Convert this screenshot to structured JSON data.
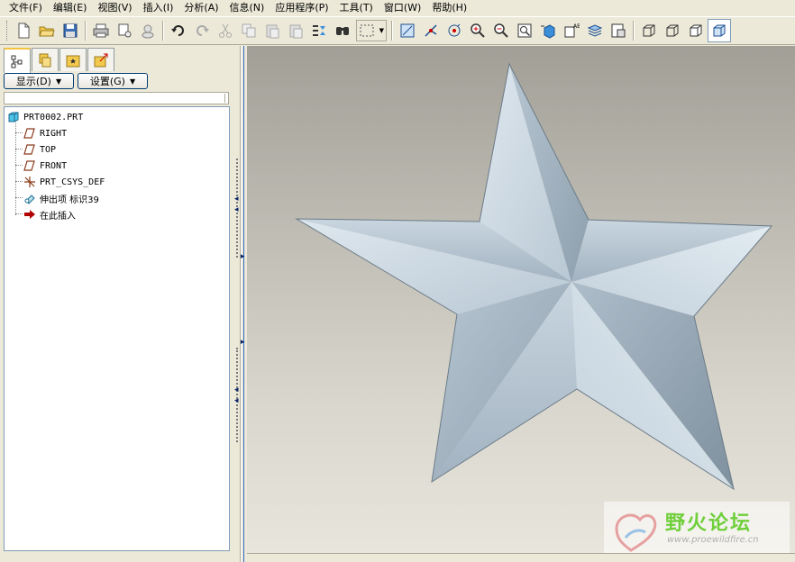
{
  "menubar": {
    "items": [
      {
        "label": "文件(F)"
      },
      {
        "label": "编辑(E)"
      },
      {
        "label": "视图(V)"
      },
      {
        "label": "插入(I)"
      },
      {
        "label": "分析(A)"
      },
      {
        "label": "信息(N)"
      },
      {
        "label": "应用程序(P)"
      },
      {
        "label": "工具(T)"
      },
      {
        "label": "窗口(W)"
      },
      {
        "label": "帮助(H)"
      }
    ]
  },
  "toolbar": {
    "icons": [
      "new-file-icon",
      "open-folder-icon",
      "save-icon",
      "print-icon",
      "send-mail-icon",
      "mail-recipient-icon",
      "undo-icon",
      "redo-icon",
      "cut-icon",
      "copy-icon",
      "paste-icon",
      "paste-special-icon",
      "regenerate-icon",
      "find-icon",
      "select-box-icon",
      "plane-display-icon",
      "axis-display-icon",
      "point-display-icon",
      "zoom-in-icon",
      "zoom-out-icon",
      "refit-icon",
      "reorient-icon",
      "saved-views-icon",
      "layers-icon",
      "view-manager-icon",
      "wireframe-icon",
      "hidden-line-icon",
      "no-hidden-icon",
      "shading-icon"
    ]
  },
  "navigator": {
    "tabs": [
      "model-tree-tab",
      "folder-browser-tab",
      "favorites-tab",
      "connections-tab"
    ],
    "show_button": "显示(D)",
    "settings_button": "设置(G)",
    "tree": {
      "root": "PRT0002.PRT",
      "items": [
        {
          "label": "RIGHT",
          "icon": "datum-plane-icon"
        },
        {
          "label": "TOP",
          "icon": "datum-plane-icon"
        },
        {
          "label": "FRONT",
          "icon": "datum-plane-icon"
        },
        {
          "label": "PRT_CSYS_DEF",
          "icon": "coordinate-system-icon"
        },
        {
          "label": "伸出项 标识39",
          "icon": "protrusion-icon"
        },
        {
          "label": "在此插入",
          "icon": "insert-here-arrow-icon"
        }
      ]
    }
  },
  "viewport": {
    "model": "five-pointed-star-solid",
    "colors": {
      "star_light": "#dbe5ec",
      "star_dark": "#8797a5",
      "background_top": "#a19f96",
      "background_bottom": "#e8e6dc"
    }
  },
  "watermark": {
    "title": "野火论坛",
    "url": "www.proewildfire.cn"
  }
}
